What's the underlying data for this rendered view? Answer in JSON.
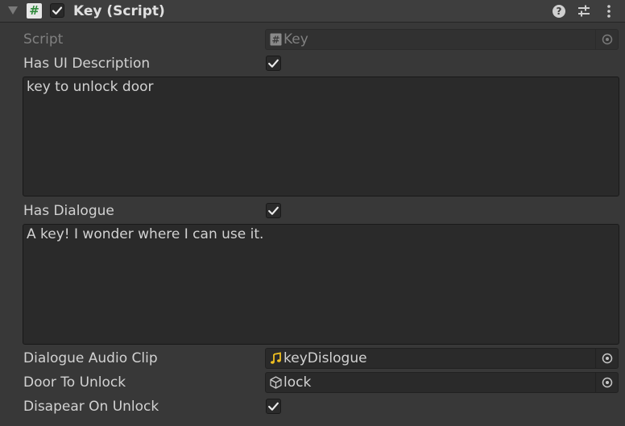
{
  "component": {
    "title": "Key (Script)",
    "enabled": true,
    "script_icon_glyph": "#",
    "icons": [
      "help-icon",
      "presets-icon",
      "menu-icon"
    ]
  },
  "fields": {
    "script": {
      "label": "Script",
      "value": "Key",
      "icon": "cs-script-icon"
    },
    "has_ui_description": {
      "label": "Has UI Description",
      "checked": true
    },
    "ui_description": "key to unlock door",
    "has_dialogue": {
      "label": "Has Dialogue",
      "checked": true
    },
    "dialogue": "A key! I wonder where I can use it.",
    "dialogue_audio_clip": {
      "label": "Dialogue Audio Clip",
      "value": "keyDislogue",
      "icon": "audio-clip-icon"
    },
    "door_to_unlock": {
      "label": "Door To Unlock",
      "value": "lock",
      "icon": "cube-icon"
    },
    "disapear_on_unlock": {
      "label": "Disapear On Unlock",
      "checked": true
    }
  },
  "colors": {
    "background": "#383838",
    "field": "#2a2a2a",
    "text": "#d2d2d2",
    "disabled_text": "#808080",
    "audio_icon": "#f0c020",
    "script_icon_hash": "#2f8a3b"
  }
}
